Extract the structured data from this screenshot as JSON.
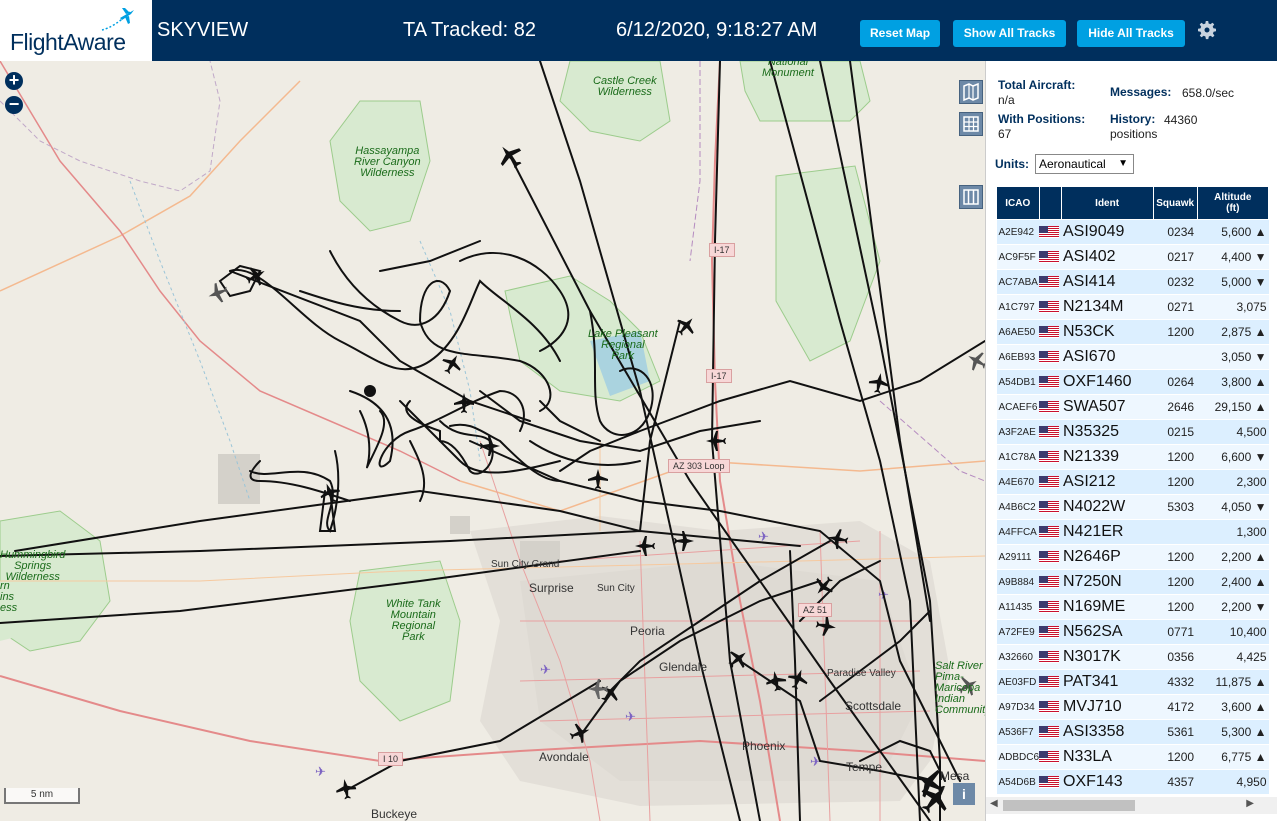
{
  "header": {
    "brand": "FlightAware",
    "app_title": "SKYVIEW",
    "tracked": "TA Tracked: 82",
    "clock": "6/12/2020, 9:18:27 AM",
    "buttons": {
      "reset": "Reset Map",
      "show_all": "Show All Tracks",
      "hide_all": "Hide All Tracks"
    },
    "colors": {
      "bar": "#002f5d",
      "button": "#00a0e2"
    }
  },
  "map": {
    "zoom_in": "+",
    "zoom_out": "−",
    "scale": "5 nm",
    "info": "i",
    "green_labels": {
      "national_monument": "National\nMonument",
      "castle_creek": "Castle Creek\nWilderness",
      "hassayampa": "Hassayampa\nRiver Canyon\nWilderness",
      "lake_pleasant": "Lake Pleasant\nRegional\nPark",
      "hummingbird": "Hummingbird\nSprings\nWilderness",
      "white_tank": "White Tank\nMountain\nRegional\nPark",
      "left_edge": "rn\nins\ness",
      "salt_river": "Salt River\nPima-\nMaricopa\nIndian\nCommunity"
    },
    "cities": {
      "sun_city_grand": "Sun City Grand",
      "surprise": "Surprise",
      "sun_city": "Sun City",
      "peoria": "Peoria",
      "glendale": "Glendale",
      "paradise_valley": "Paradise Valley",
      "scottsdale": "Scottsdale",
      "avondale": "Avondale",
      "phoenix": "Phoenix",
      "tempe": "Tempe",
      "mesa": "Mesa",
      "buckeye": "Buckeye"
    },
    "shields": {
      "i17_north": "I-17",
      "i17_south": "I-17",
      "az303": "AZ 303 Loop",
      "az51": "AZ 51",
      "i10": "I 10"
    }
  },
  "stats": {
    "total_label": "Total Aircraft:",
    "total_value": "n/a",
    "positions_label": "With Positions:",
    "positions_value": "67",
    "messages_label": "Messages:",
    "messages_value": "658.0/sec",
    "history_label": "History:",
    "history_value": "44360",
    "history_unit": "positions"
  },
  "units": {
    "label": "Units:",
    "selected": "Aeronautical"
  },
  "table": {
    "headers": {
      "icao": "ICAO",
      "flag": "",
      "ident": "Ident",
      "squawk": "Squawk",
      "altitude": "Altitude\n(ft)"
    },
    "rows": [
      {
        "icao": "A2E942",
        "ident": "ASI9049",
        "squawk": "0234",
        "alt": "5,600 ▲"
      },
      {
        "icao": "AC9F5F",
        "ident": "ASI402",
        "squawk": "0217",
        "alt": "4,400 ▼"
      },
      {
        "icao": "AC7ABA",
        "ident": "ASI414",
        "squawk": "0232",
        "alt": "5,000 ▼"
      },
      {
        "icao": "A1C797",
        "ident": "N2134M",
        "squawk": "0271",
        "alt": "3,075"
      },
      {
        "icao": "A6AE50",
        "ident": "N53CK",
        "squawk": "1200",
        "alt": "2,875 ▲"
      },
      {
        "icao": "A6EB93",
        "ident": "ASI670",
        "squawk": "",
        "alt": "3,050 ▼"
      },
      {
        "icao": "A54DB1",
        "ident": "OXF1460",
        "squawk": "0264",
        "alt": "3,800 ▲"
      },
      {
        "icao": "ACAEF6",
        "ident": "SWA507",
        "squawk": "2646",
        "alt": "29,150 ▲"
      },
      {
        "icao": "A3F2AE",
        "ident": "N35325",
        "squawk": "0215",
        "alt": "4,500"
      },
      {
        "icao": "A1C78A",
        "ident": "N21339",
        "squawk": "1200",
        "alt": "6,600 ▼"
      },
      {
        "icao": "A4E670",
        "ident": "ASI212",
        "squawk": "1200",
        "alt": "2,300"
      },
      {
        "icao": "A4B6C2",
        "ident": "N4022W",
        "squawk": "5303",
        "alt": "4,050 ▼"
      },
      {
        "icao": "A4FFCA",
        "ident": "N421ER",
        "squawk": "",
        "alt": "1,300"
      },
      {
        "icao": "A29111",
        "ident": "N2646P",
        "squawk": "1200",
        "alt": "2,200 ▲"
      },
      {
        "icao": "A9B884",
        "ident": "N7250N",
        "squawk": "1200",
        "alt": "2,400 ▲"
      },
      {
        "icao": "A11435",
        "ident": "N169ME",
        "squawk": "1200",
        "alt": "2,200 ▼"
      },
      {
        "icao": "A72FE9",
        "ident": "N562SA",
        "squawk": "0771",
        "alt": "10,400"
      },
      {
        "icao": "A32660",
        "ident": "N3017K",
        "squawk": "0356",
        "alt": "4,425"
      },
      {
        "icao": "AE03FD",
        "ident": "PAT341",
        "squawk": "4332",
        "alt": "11,875 ▲"
      },
      {
        "icao": "A97D34",
        "ident": "MVJ710",
        "squawk": "4172",
        "alt": "3,600 ▲"
      },
      {
        "icao": "A536F7",
        "ident": "ASI3358",
        "squawk": "5361",
        "alt": "5,300 ▲"
      },
      {
        "icao": "ADBDC6",
        "ident": "N33LA",
        "squawk": "1200",
        "alt": "6,775 ▲"
      },
      {
        "icao": "A54D6B",
        "ident": "OXF143",
        "squawk": "4357",
        "alt": "4,950"
      }
    ]
  },
  "scroll": {
    "left": "◀",
    "right": "▶"
  }
}
